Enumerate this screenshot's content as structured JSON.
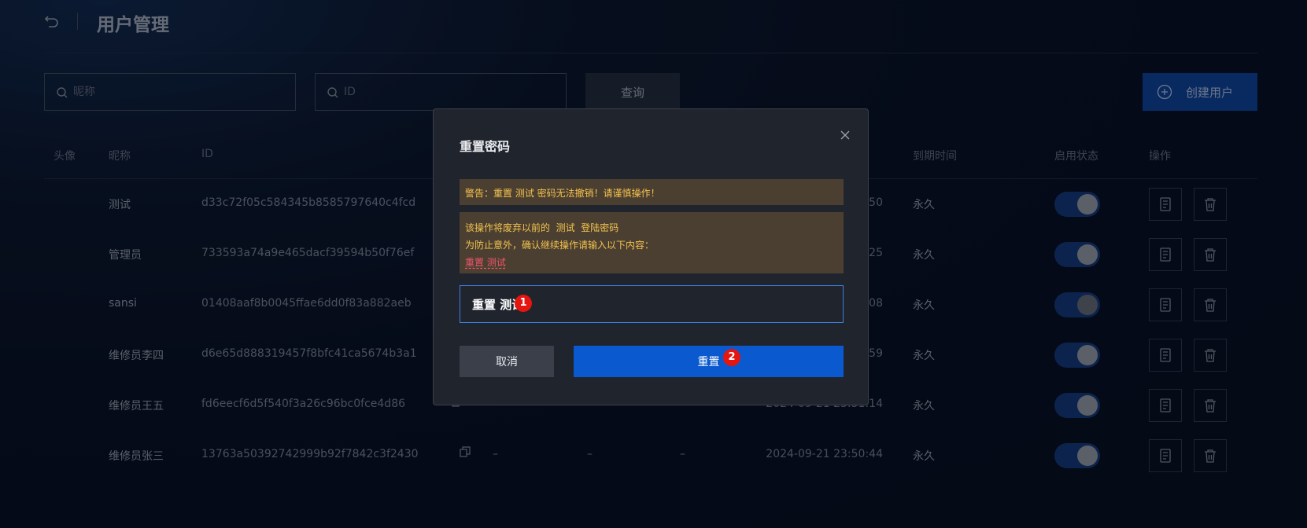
{
  "header": {
    "title": "用户管理",
    "back_icon": "undo-arrow-icon"
  },
  "search": {
    "nickname_placeholder": "昵称",
    "id_placeholder": "ID",
    "query_label": "查询",
    "create_label": "创建用户"
  },
  "table": {
    "columns": {
      "avatar": "头像",
      "nickname": "昵称",
      "id": "ID",
      "expire": "到期时间",
      "status": "启用状态",
      "actions": "操作"
    },
    "rows": [
      {
        "nickname": "测试",
        "id": "d33c72f05c584345b8585797640c4fcd",
        "c1": "",
        "c2": "",
        "c3": "",
        "time_tail": ":50",
        "expire": "永久",
        "enabled": true
      },
      {
        "nickname": "管理员",
        "id": "733593a74a9e465dacf39594b50f76ef",
        "c1": "",
        "c2": "",
        "c3": "",
        "time_tail": ":25",
        "expire": "永久",
        "enabled": true
      },
      {
        "nickname": "sansi",
        "id": "01408aaf8b0045ffae6dd0f83a882aeb",
        "c1": "",
        "c2": "",
        "c3": "",
        "time_tail": "08",
        "expire": "永久",
        "enabled": false
      },
      {
        "nickname": "维修员李四",
        "id": "d6e65d888319457f8bfc41ca5674b3a1",
        "c1": "",
        "c2": "",
        "c3": "",
        "time_tail": ":59",
        "expire": "永久",
        "enabled": true
      },
      {
        "nickname": "维修员王五",
        "id": "fd6eecf6d5f540f3a26c96bc0fce4d86",
        "c1": "–",
        "c2": "–",
        "c3": "–",
        "time_tail": "2024-09-21 23:51:14",
        "expire": "永久",
        "enabled": true
      },
      {
        "nickname": "维修员张三",
        "id": "13763a50392742999b92f7842c3f2430",
        "c1": "–",
        "c2": "–",
        "c3": "–",
        "time_tail": "2024-09-21 23:50:44",
        "expire": "永久",
        "enabled": true
      }
    ]
  },
  "modal": {
    "title": "重置密码",
    "warning": "警告：重置 测试 密码无法撤销！请谨慎操作！",
    "info_line1": "该操作将废弃以前的  测试  登陆密码",
    "info_line2": "为防止意外，确认继续操作请输入以下内容：",
    "confirm_word": "重置 测试",
    "input_value": "重置 测试",
    "cancel_label": "取消",
    "reset_label": "重置",
    "badge1": "1",
    "badge2": "2"
  },
  "colors": {
    "primary": "#0a59cf",
    "warning_text": "#f3c24f",
    "warning_bg": "#4b3f31",
    "danger": "#f0556b",
    "badge": "#e4160f"
  }
}
